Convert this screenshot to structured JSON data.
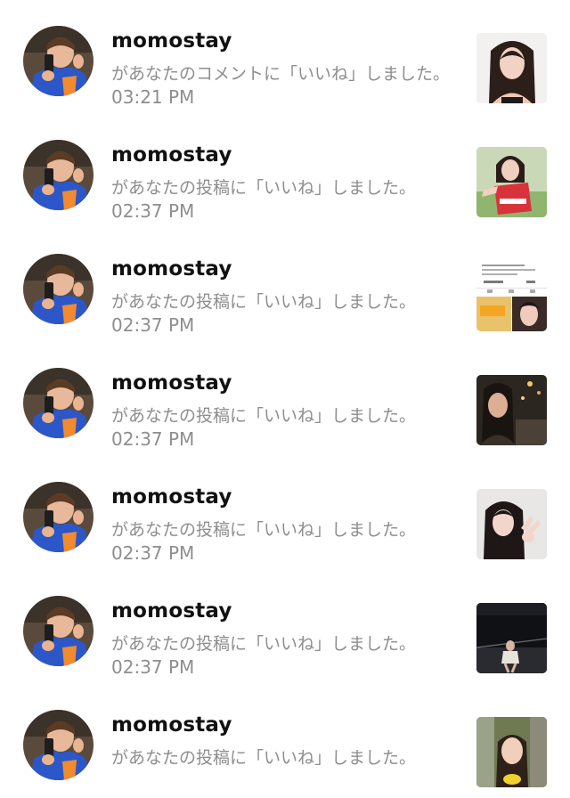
{
  "notifications": [
    {
      "username": "momostay",
      "message": "があなたのコメントに「いいね」しました。",
      "time": "03:21 PM",
      "thumbnail": "portrait-woman-long-hair"
    },
    {
      "username": "momostay",
      "message": "があなたの投稿に「いいね」しました。",
      "time": "02:37 PM",
      "thumbnail": "dancer-red-outfit"
    },
    {
      "username": "momostay",
      "message": "があなたの投稿に「いいね」しました。",
      "time": "02:37 PM",
      "thumbnail": "profile-screenshot"
    },
    {
      "username": "momostay",
      "message": "があなたの投稿に「いいね」しました。",
      "time": "02:37 PM",
      "thumbnail": "night-street-woman"
    },
    {
      "username": "momostay",
      "message": "があなたの投稿に「いいね」しました。",
      "time": "02:37 PM",
      "thumbnail": "peace-sign-woman"
    },
    {
      "username": "momostay",
      "message": "があなたの投稿に「いいね」しました。",
      "time": "02:37 PM",
      "thumbnail": "dark-stage-dancer"
    },
    {
      "username": "momostay",
      "message": "があなたの投稿に「いいね」しました。",
      "time": "",
      "thumbnail": "outdoor-woman-flowers"
    }
  ]
}
